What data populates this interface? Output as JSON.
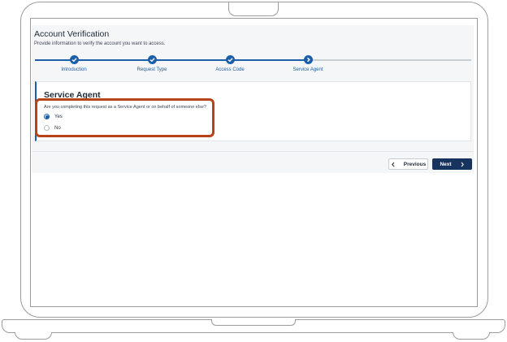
{
  "page": {
    "title": "Account Verification",
    "subtitle": "Provide information to verify the account you want to access."
  },
  "stepper": {
    "steps": [
      {
        "label": "Introduction",
        "icon": "check-icon",
        "state": "complete"
      },
      {
        "label": "Request Type",
        "icon": "check-icon",
        "state": "complete"
      },
      {
        "label": "Access Code",
        "icon": "check-icon",
        "state": "complete"
      },
      {
        "label": "Service Agent",
        "icon": "chevron-right-icon",
        "state": "current"
      }
    ]
  },
  "card": {
    "title": "Service Agent",
    "question": "Are you completing this request as a Service Agent or on behalf of someone else?",
    "options": [
      {
        "label": "Yes",
        "selected": true
      },
      {
        "label": "No",
        "selected": false
      }
    ]
  },
  "actions": {
    "previous_label": "Previous",
    "next_label": "Next"
  },
  "colors": {
    "accent": "#1b5fa8",
    "primary_button": "#17345f",
    "highlight": "#b5441b"
  }
}
